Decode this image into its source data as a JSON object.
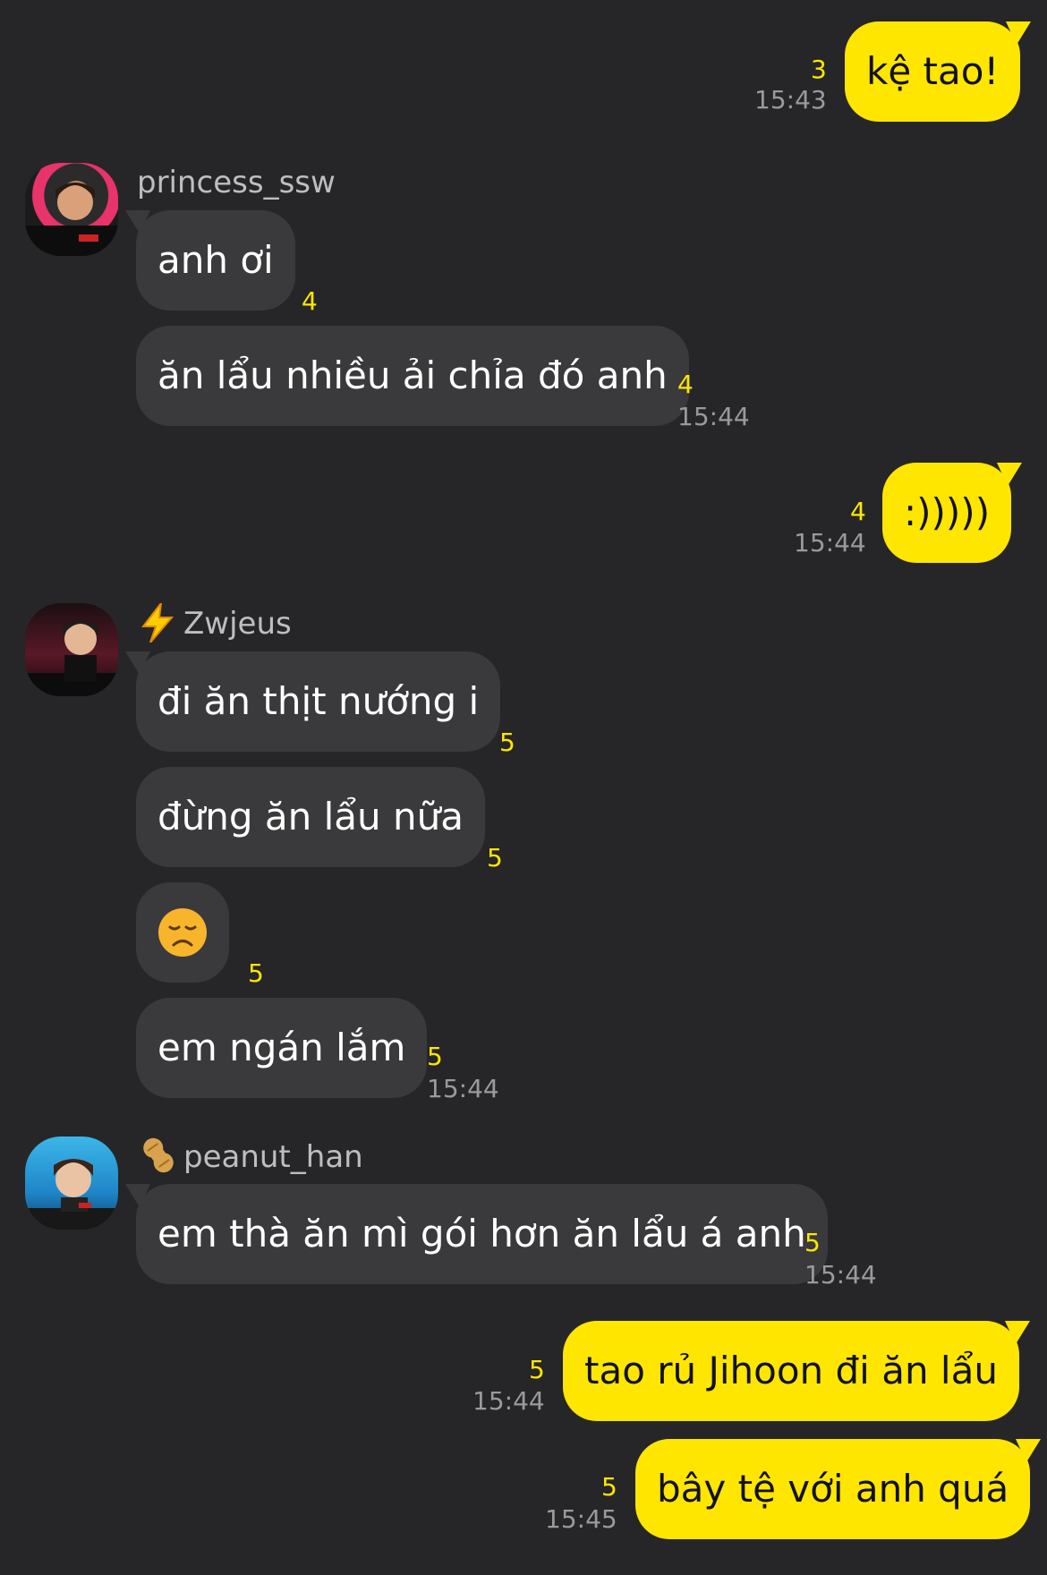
{
  "messages": [
    {
      "text": "kệ tao!",
      "count": "3",
      "time": "15:43"
    },
    {
      "sender": "princess_ssw",
      "text": "anh ơi",
      "count": "4"
    },
    {
      "text": "ăn lẩu nhiều ải chỉa đó anh",
      "count": "4",
      "time": "15:44"
    },
    {
      "text": ":)))))",
      "count": "4",
      "time": "15:44"
    },
    {
      "sender": "Zwjeus",
      "text": "đi ăn thịt nướng i",
      "count": "5"
    },
    {
      "text": "đừng ăn lẩu nữa",
      "count": "5"
    },
    {
      "emoji": "😞",
      "count": "5"
    },
    {
      "text": "em ngán lắm",
      "count": "5",
      "time": "15:44"
    },
    {
      "sender": "peanut_han",
      "text": "em thà ăn mì gói hơn ăn lẩu á anh",
      "count": "5",
      "time": "15:44"
    },
    {
      "text": "tao rủ Jihoon đi ăn lẩu",
      "count": "5",
      "time": "15:44"
    },
    {
      "text": "bây tệ với anh quá",
      "count": "5",
      "time": "15:45"
    }
  ],
  "icons": {
    "zwjeus_badge": "lightning-icon",
    "peanut_badge": "peanut-icon"
  },
  "colors": {
    "background": "#262628",
    "incoming_bubble": "#3a3a3c",
    "outgoing_bubble": "#ffe600",
    "unread_count": "#ffe600",
    "timestamp": "#9a9a9e"
  }
}
